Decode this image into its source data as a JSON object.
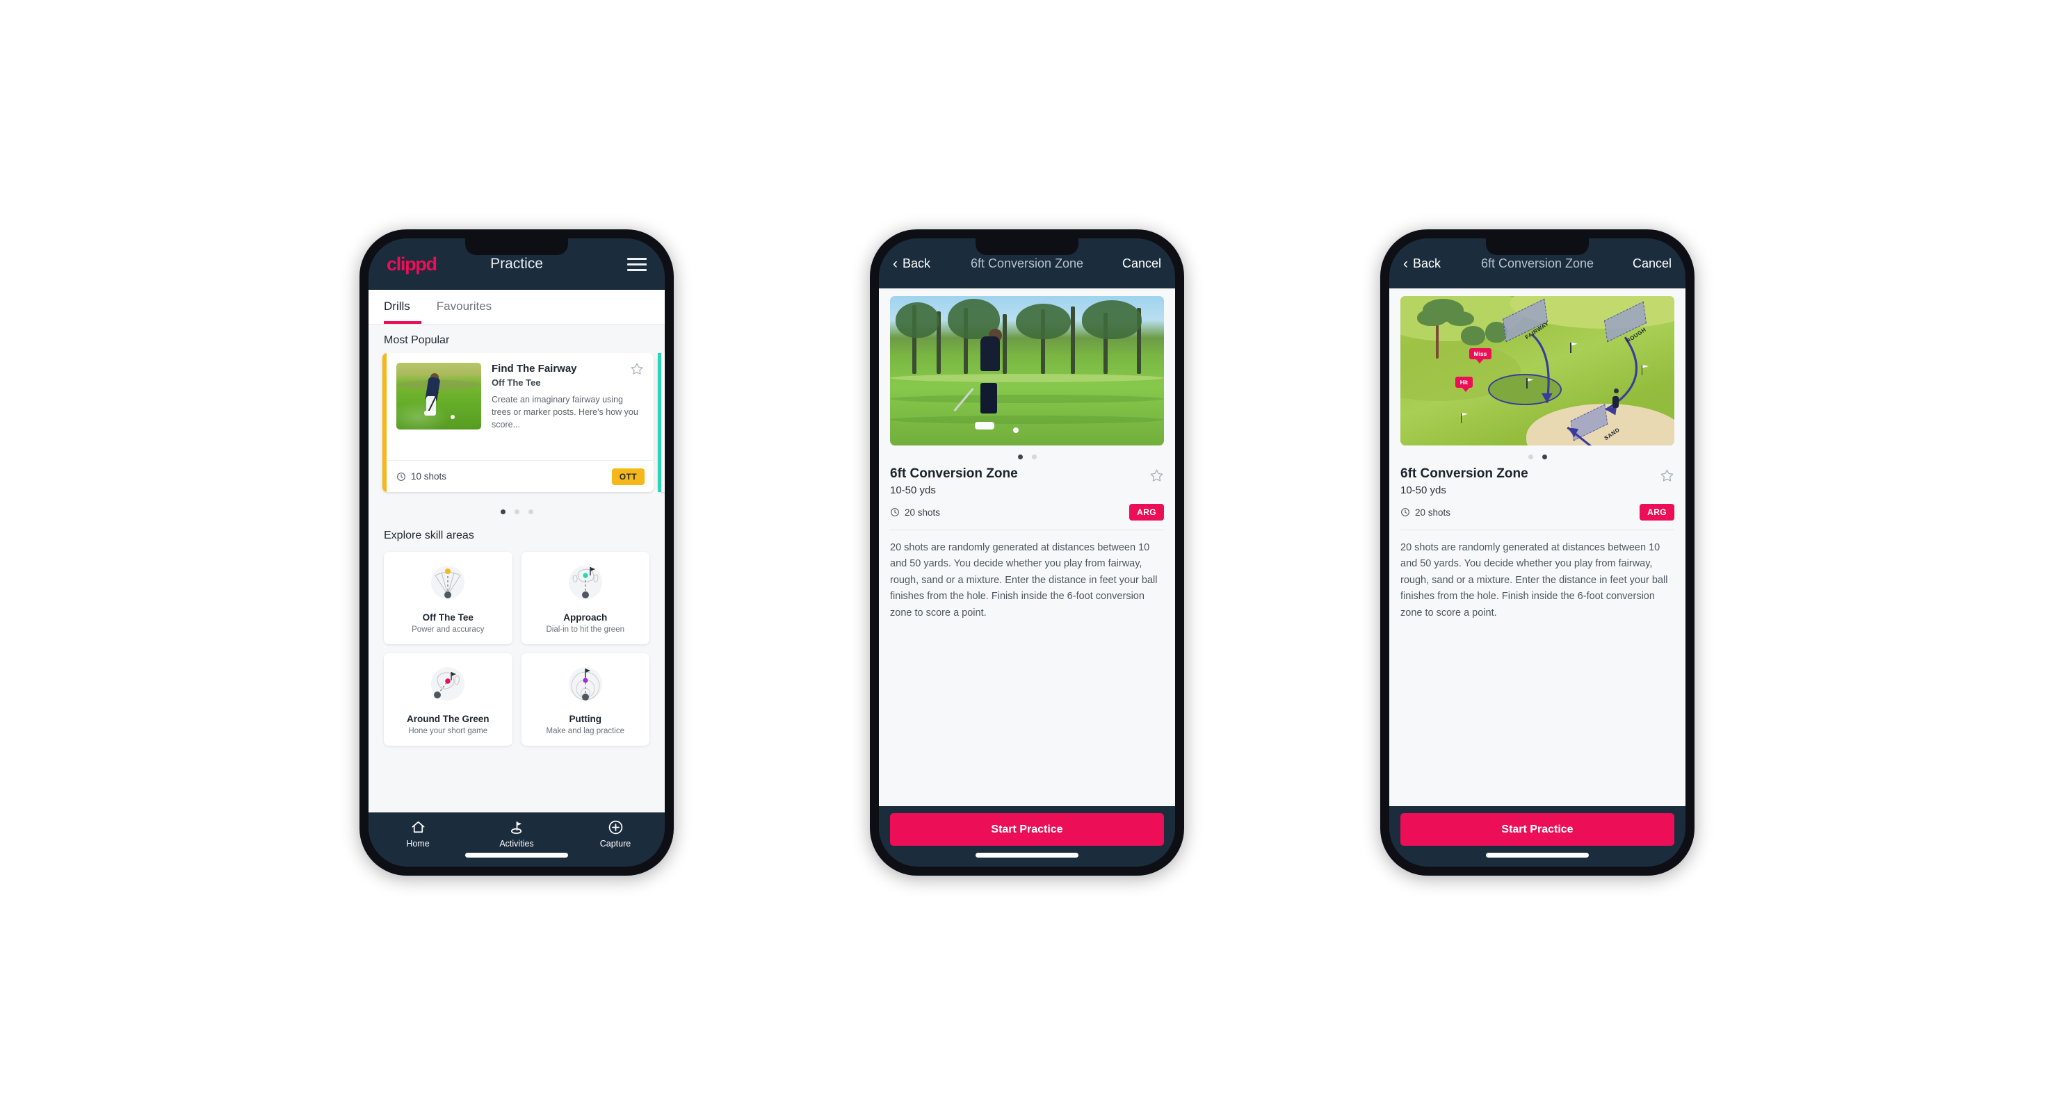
{
  "app": {
    "brand": "clippd",
    "accent_pink": "#ec0e56",
    "dark_navy": "#1b2c3d",
    "amber": "#f5b719",
    "teal": "#2ad6b5"
  },
  "phone1": {
    "header": {
      "title": "Practice",
      "menu_icon": "hamburger-icon",
      "logo": "clippd"
    },
    "tabs": [
      {
        "label": "Drills",
        "active": true
      },
      {
        "label": "Favourites",
        "active": false
      }
    ],
    "most_popular": {
      "section_title": "Most Popular",
      "card": {
        "name": "Find The Fairway",
        "category": "Off The Tee",
        "description": "Create an imaginary fairway using trees or marker posts. Here's how you score...",
        "shots": "10 shots",
        "badge": "OTT",
        "accent": "#f5b719",
        "star_icon": "star-outline-icon",
        "clock_icon": "clock-icon"
      },
      "dots": {
        "count": 3,
        "active": 0
      }
    },
    "skills": {
      "section_title": "Explore skill areas",
      "items": [
        {
          "name": "Off The Tee",
          "desc": "Power and accuracy",
          "icon": "off-the-tee-icon",
          "dot": "#f5b719"
        },
        {
          "name": "Approach",
          "desc": "Dial-in to hit the green",
          "icon": "approach-icon",
          "dot": "#2ad6b5"
        },
        {
          "name": "Around The Green",
          "desc": "Hone your short game",
          "icon": "around-the-green-icon",
          "dot": "#ec0e56"
        },
        {
          "name": "Putting",
          "desc": "Make and lag practice",
          "icon": "putting-icon",
          "dot": "#9b30d9"
        }
      ]
    },
    "bottom_nav": [
      {
        "label": "Home",
        "icon": "home-icon",
        "active": false
      },
      {
        "label": "Activities",
        "icon": "flag-green-icon",
        "active": true
      },
      {
        "label": "Capture",
        "icon": "plus-circle-icon",
        "active": false
      }
    ]
  },
  "phone2": {
    "header": {
      "back": "Back",
      "title": "6ft Conversion Zone",
      "cancel": "Cancel",
      "back_icon": "chevron-left-icon"
    },
    "media": {
      "type": "photo",
      "alt": "golfer-chipping-photo"
    },
    "dots": {
      "count": 2,
      "active": 0
    },
    "detail": {
      "title": "6ft Conversion Zone",
      "yards": "10-50 yds",
      "shots": "20 shots",
      "badge": "ARG",
      "star_icon": "star-outline-icon",
      "clock_icon": "clock-icon",
      "description": "20 shots are randomly generated at distances between 10 and 50 yards. You decide whether you play from fairway, rough, sand or a mixture. Enter the distance in feet your ball finishes from the hole. Finish inside the 6-foot conversion zone to score a point."
    },
    "cta": "Start Practice"
  },
  "phone3": {
    "header": {
      "back": "Back",
      "title": "6ft Conversion Zone",
      "cancel": "Cancel",
      "back_icon": "chevron-left-icon"
    },
    "media": {
      "type": "illustration",
      "alt": "golf-course-diagram",
      "labels": [
        "FAIRWAY",
        "ROUGH",
        "SAND"
      ],
      "tags": [
        "Miss",
        "Hit"
      ]
    },
    "dots": {
      "count": 2,
      "active": 1
    },
    "detail": {
      "title": "6ft Conversion Zone",
      "yards": "10-50 yds",
      "shots": "20 shots",
      "badge": "ARG",
      "star_icon": "star-outline-icon",
      "clock_icon": "clock-icon",
      "description": "20 shots are randomly generated at distances between 10 and 50 yards. You decide whether you play from fairway, rough, sand or a mixture. Enter the distance in feet your ball finishes from the hole. Finish inside the 6-foot conversion zone to score a point."
    },
    "cta": "Start Practice"
  }
}
